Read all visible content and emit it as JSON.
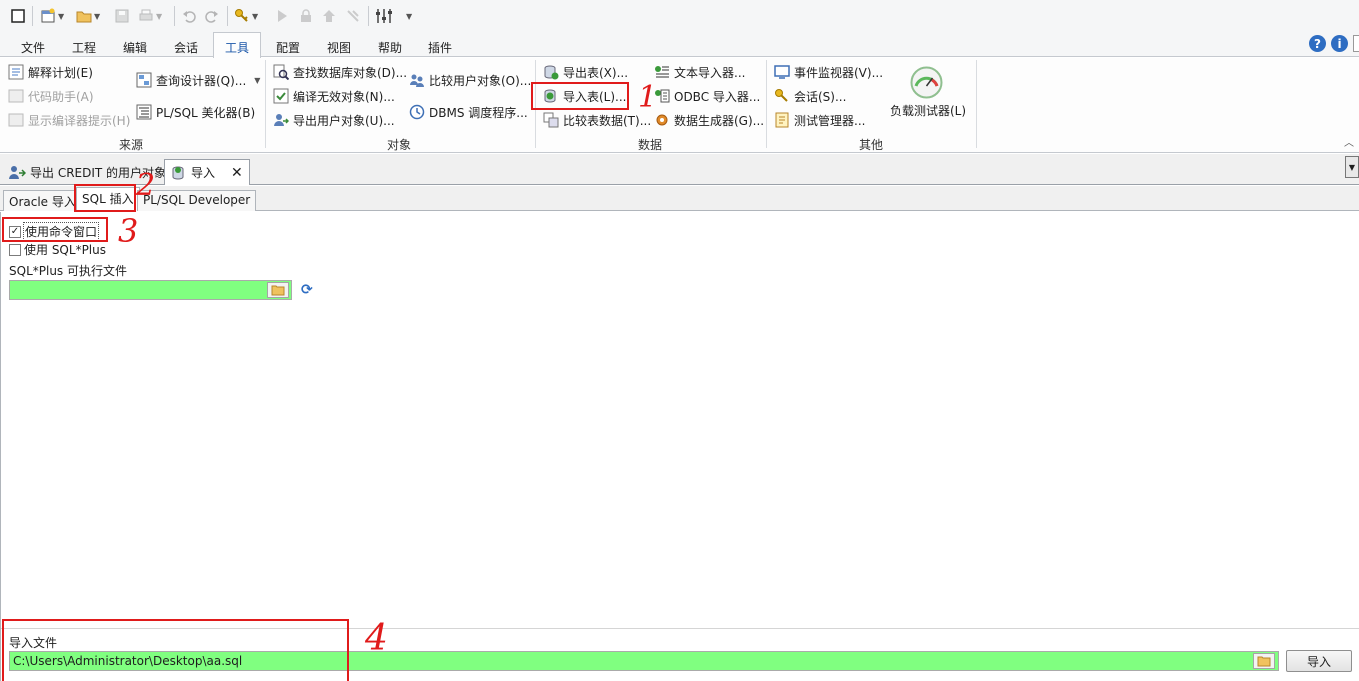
{
  "ribbon_tabs": [
    "文件",
    "工程",
    "编辑",
    "会话",
    "工具",
    "配置",
    "视图",
    "帮助",
    "插件"
  ],
  "active_ribbon_tab": "工具",
  "help": {
    "question": "?",
    "info": "i"
  },
  "groups": {
    "source": {
      "label": "来源",
      "items": [
        "解释计划(E)",
        "代码助手(A)",
        "显示编译器提示(H)",
        "查询设计器(Q)...",
        "PL/SQL 美化器(B)"
      ]
    },
    "objects": {
      "label": "对象",
      "items": [
        "查找数据库对象(D)...",
        "编译无效对象(N)...",
        "导出用户对象(U)...",
        "比较用户对象(O)...",
        "DBMS 调度程序..."
      ]
    },
    "data": {
      "label": "数据",
      "items": [
        "导出表(X)...",
        "导入表(L)...",
        "比较表数据(T)...",
        "文本导入器...",
        "ODBC 导入器...",
        "数据生成器(G)..."
      ]
    },
    "other": {
      "label": "其他",
      "items": [
        "事件监视器(V)...",
        "会话(S)...",
        "测试管理器...",
        "负载测试器(L)"
      ]
    }
  },
  "doc_tabs": [
    "导出 CREDIT 的用户对象",
    "导入"
  ],
  "doc_close": "✕",
  "sub_tabs": [
    "Oracle 导入",
    "SQL 插入",
    "PL/SQL Developer"
  ],
  "active_sub_tab": "SQL 插入",
  "options": {
    "use_command_window": "使用命令窗口",
    "use_command_window_checked": true,
    "use_sqlplus": "使用 SQL*Plus",
    "use_sqlplus_checked": false,
    "sqlplus_exe_label": "SQL*Plus 可执行文件",
    "sqlplus_exe_value": ""
  },
  "import_file": {
    "label": "导入文件",
    "value": "C:\\Users\\Administrator\\Desktop\\aa.sql",
    "button": "导入"
  },
  "annotations": [
    "1",
    "2",
    "3",
    "4"
  ]
}
